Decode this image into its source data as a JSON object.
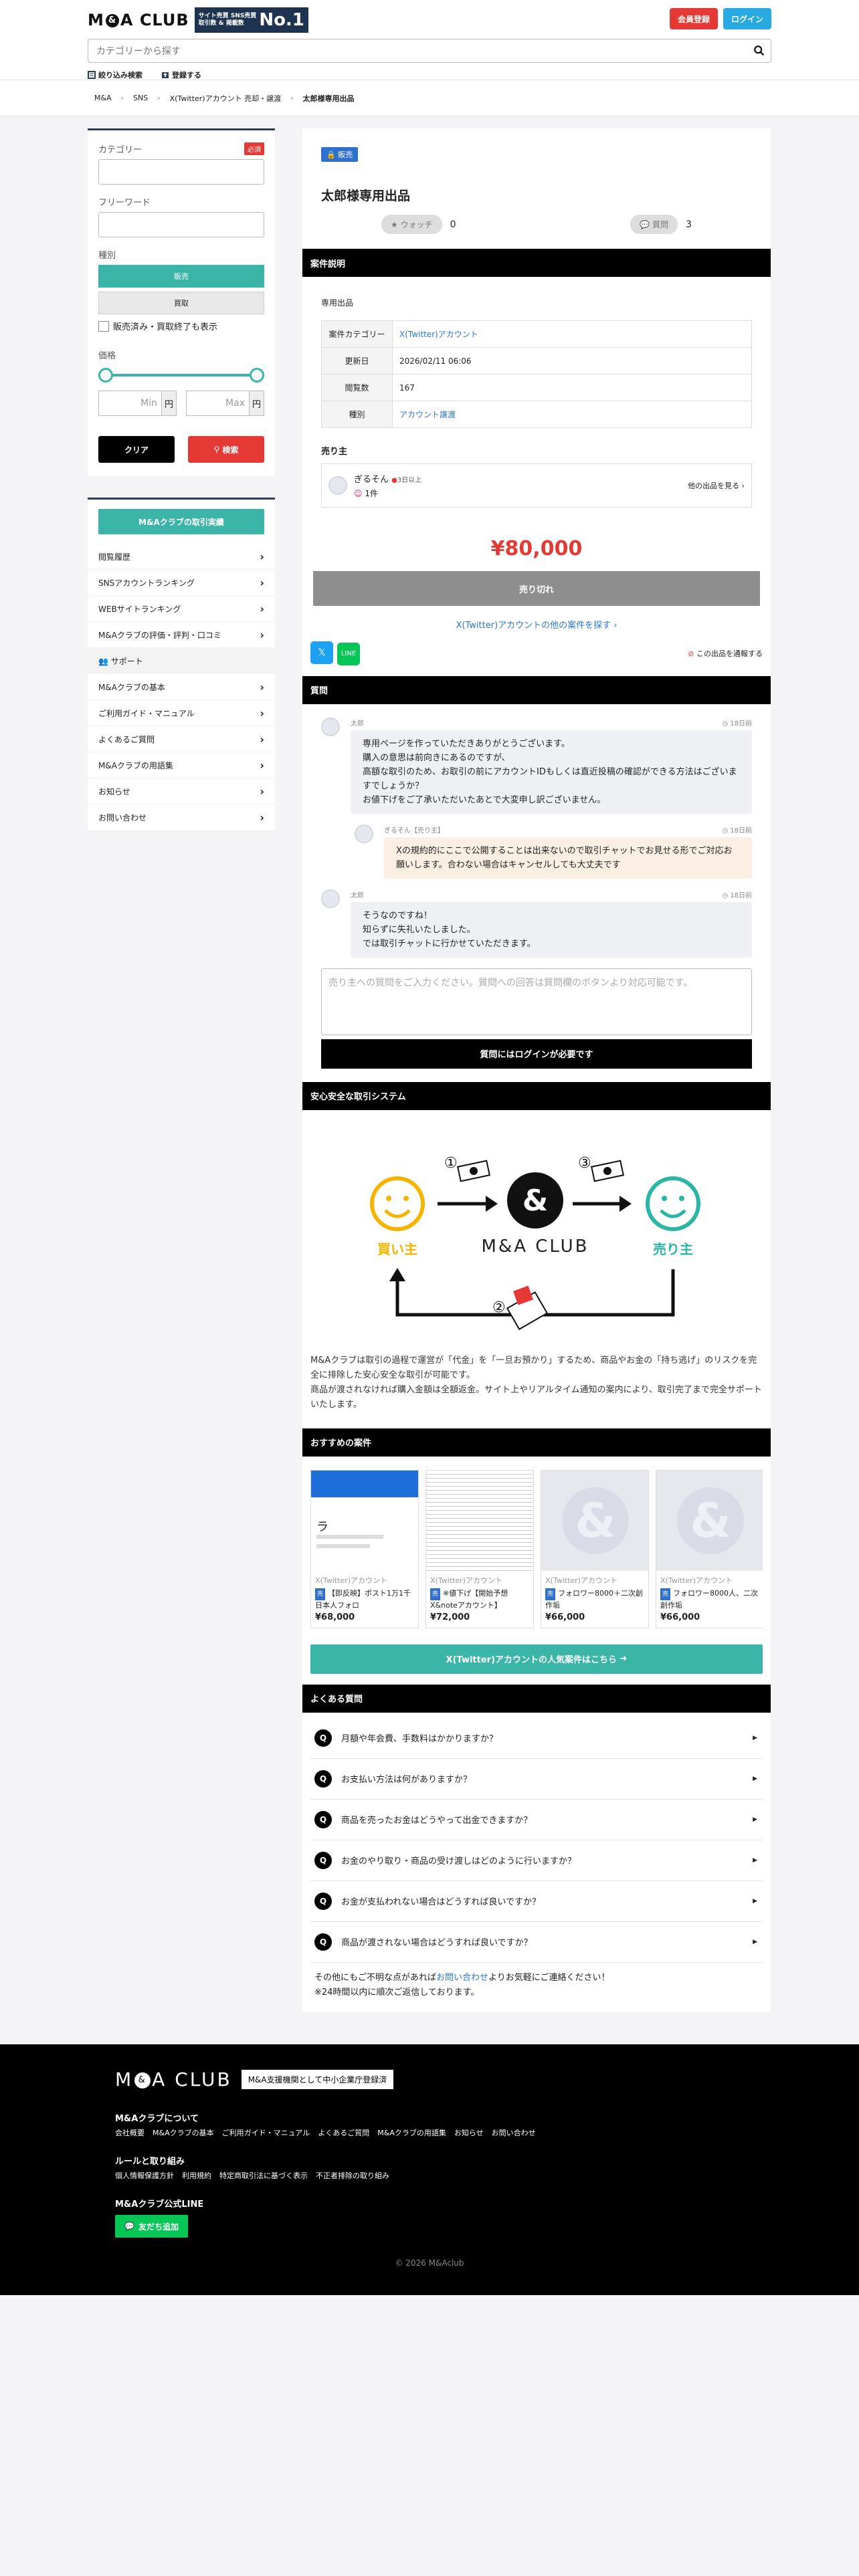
{
  "header": {
    "logo": "M&A CLUB",
    "no1_line1": "サイト売買",
    "no1_line2": "取引数 & 掲載数",
    "no1_sns": "SNS売買",
    "no1_big": "No.1",
    "register": "会員登録",
    "login": "ログイン",
    "search_placeholder": "カテゴリーから探す",
    "filter": "絞り込み検索",
    "listing": "登録する"
  },
  "breadcrumb": [
    "M&A",
    "SNS",
    "X(Twitter)アカウント 売却・譲渡",
    "太郎様専用出品"
  ],
  "sidebar": {
    "category": "カテゴリー",
    "required": "必須",
    "freeword": "フリーワード",
    "type": "種別",
    "sell": "販売",
    "buy": "買取",
    "include_sold": "販売済み・買取終了も表示",
    "price": "価格",
    "min": "Min",
    "max": "Max",
    "yen": "円",
    "clear": "クリア",
    "search": "検索",
    "menu_top": "M&Aクラブの取引実績",
    "menu": [
      "閲覧履歴",
      "SNSアカウントランキング",
      "WEBサイトランキング",
      "M&Aクラブの評価・評判・口コミ"
    ],
    "support": "サポート",
    "support_menu": [
      "M&Aクラブの基本",
      "ご利用ガイド・マニュアル",
      "よくあるご質問",
      "M&Aクラブの用語集",
      "お知らせ",
      "お問い合わせ"
    ]
  },
  "listing": {
    "badge": "販売",
    "title": "太郎様専用出品",
    "watch_label": "ウォッチ",
    "watch_count": "0",
    "question_label": "質問",
    "question_count": "3",
    "section_desc": "案件説明",
    "desc": "専用出品",
    "rows": [
      {
        "k": "案件カテゴリー",
        "v": "X(Twitter)アカウント",
        "link": true
      },
      {
        "k": "更新日",
        "v": "2026/02/11 06:06",
        "link": false
      },
      {
        "k": "閲覧数",
        "v": "167",
        "link": false
      },
      {
        "k": "種別",
        "v": "アカウント譲渡",
        "link": true
      }
    ],
    "seller_heading": "売り主",
    "seller_name": "ぎるそん",
    "seller_status": "3日以上",
    "seller_count": "1件",
    "seller_more": "他の出品を見る",
    "price": "¥80,000",
    "sold": "売り切れ",
    "more_link": "X(Twitter)アカウントの他の案件を探す",
    "report": "この出品を通報する"
  },
  "qa": {
    "heading": "質問",
    "messages": [
      {
        "who": "太郎",
        "time": "18日前",
        "text": "専用ページを作っていただきありがとうございます。\n購入の意思は前向きにあるのですが、\n高額な取引のため、お取引の前にアカウントIDもしくは直近投稿の確認ができる方法はございますでしょうか？\nお値下げをご了承いただいたあとで大変申し訳ございません。",
        "reply": false
      },
      {
        "who": "ぎるそん【売り主】",
        "time": "18日前",
        "text": "Xの規約的にここで公開することは出来ないので取引チャットでお見せる形でご対応お願いします。合わない場合はキャンセルしても大丈夫です",
        "reply": true
      },
      {
        "who": "太郎",
        "time": "18日前",
        "text": "そうなのですね！\n知らずに失礼いたしました。\nでは取引チャットに行かせていただきます。",
        "reply": false
      }
    ],
    "placeholder": "売り主への質問をご入力ください。質問への回答は質問欄のボタンより対応可能です。",
    "login_required": "質問にはログインが必要です"
  },
  "safe": {
    "heading": "安心安全な取引システム",
    "buyer": "買い主",
    "seller": "売り主",
    "club": "M&A CLUB",
    "step1": "①",
    "step2": "②",
    "step3": "③",
    "text": "M&Aクラブは取引の過程で運営が「代金」を「一旦お預かり」するため、商品やお金の「持ち逃げ」のリスクを完全に排除した安心安全な取引が可能です。\n商品が渡されなければ購入金額は全額返金。サイト上やリアルタイム通知の案内により、取引完了まで完全サポートいたします。"
  },
  "reco": {
    "heading": "おすすめの案件",
    "items": [
      {
        "cat": "X(Twitter)アカウント",
        "badge": "売",
        "name": "【即反映】ポスト1万1千日本人フォロ",
        "price": "¥68,000"
      },
      {
        "cat": "X(Twitter)アカウント",
        "badge": "売",
        "name": "※値下げ【開始予想X&noteアカウント】",
        "price": "¥72,000"
      },
      {
        "cat": "X(Twitter)アカウント",
        "badge": "売",
        "name": "フォロワー8000＋二次創作垢",
        "price": "¥66,000"
      },
      {
        "cat": "X(Twitter)アカウント",
        "badge": "売",
        "name": "フォロワー8000人、二次創作垢",
        "price": "¥66,000"
      }
    ],
    "popular": "X(Twitter)アカウントの人気案件はこちら"
  },
  "faq": {
    "heading": "よくある質問",
    "items": [
      "月額や年会費、手数料はかかりますか？",
      "お支払い方法は何がありますか？",
      "商品を売ったお金はどうやって出金できますか？",
      "お金のやり取り・商品の受け渡しはどのように行いますか？",
      "お金が支払われない場合はどうすれば良いですか？",
      "商品が渡されない場合はどうすれば良いですか？"
    ],
    "note_pre": "その他にもご不明な点があれば",
    "note_link": "お問い合わせ",
    "note_post": "よりお気軽にご連絡ください！",
    "note2": "※24時間以内に順次ご返信しております。"
  },
  "footer": {
    "logo": "M&A CLUB",
    "tag": "M&A支援機関として中小企業庁登録済",
    "about": "M&Aクラブについて",
    "about_links": [
      "会社概要",
      "M&Aクラブの基本",
      "ご利用ガイド・マニュアル",
      "よくあるご質問",
      "M&Aクラブの用語集",
      "お知らせ",
      "お問い合わせ"
    ],
    "rules": "ルールと取り組み",
    "rule_links": [
      "個人情報保護方針",
      "利用規約",
      "特定商取引法に基づく表示",
      "不正者排除の取り組み"
    ],
    "line_title": "M&Aクラブ公式LINE",
    "line_btn": "友だち追加",
    "copy": "© 2026 M&Aclub"
  },
  "colors": {
    "teal": "#3bb5a8",
    "red": "#e53935",
    "navy": "#1e3350",
    "blue": "#2a79d0",
    "line": "#06c755"
  }
}
